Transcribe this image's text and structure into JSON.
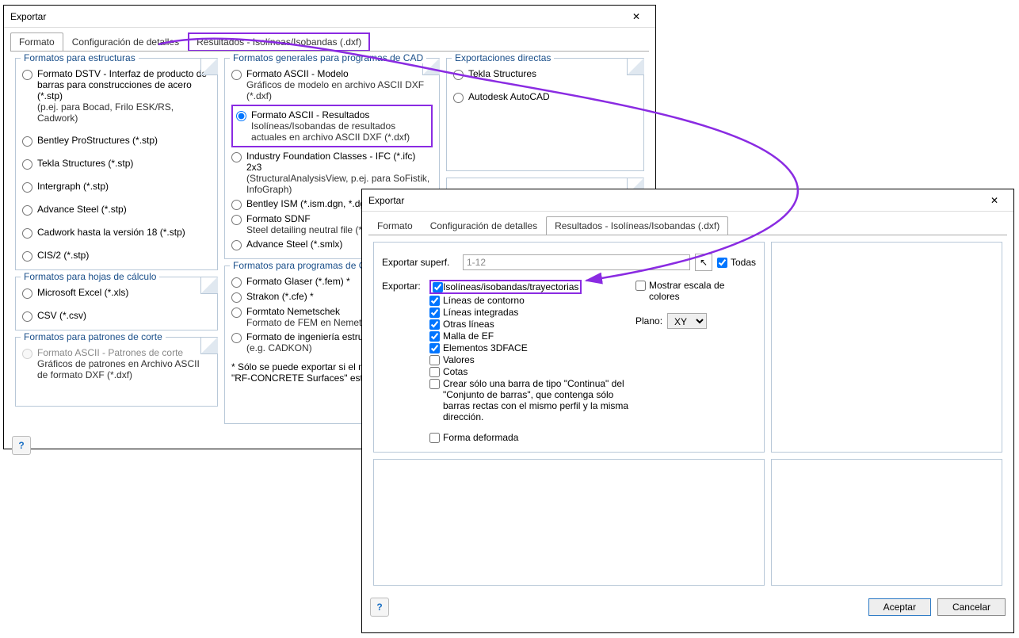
{
  "dialog1": {
    "title": "Exportar",
    "tabs": [
      "Formato",
      "Configuración de detalles",
      "Resultados - Isolíneas/Isobandas (.dxf)"
    ],
    "groups": {
      "estructuras": {
        "title": "Formatos para estructuras",
        "items": [
          {
            "label": "Formato DSTV - Interfaz de producto de barras para construcciones de acero (*.stp)",
            "sub": "(p.ej. para Bocad, Frilo ESK/RS, Cadwork)"
          },
          {
            "label": "Bentley ProStructures (*.stp)"
          },
          {
            "label": "Tekla Structures (*.stp)"
          },
          {
            "label": "Intergraph (*.stp)"
          },
          {
            "label": "Advance Steel (*.stp)"
          },
          {
            "label": "Cadwork hasta la versión 18 (*.stp)"
          },
          {
            "label": "CIS/2 (*.stp)"
          }
        ]
      },
      "hojas": {
        "title": "Formatos para hojas de cálculo",
        "items": [
          {
            "label": "Microsoft Excel (*.xls)"
          },
          {
            "label": "CSV (*.csv)"
          }
        ]
      },
      "patrones": {
        "title": "Formatos para patrones de corte",
        "items": [
          {
            "label": "Formato ASCII - Patrones de corte",
            "sub": "Gráficos de patrones en\nArchivo ASCII de formato DXF (*.dxf)",
            "disabled": true
          }
        ]
      },
      "cad": {
        "title": "Formatos generales para programas de CAD",
        "items": [
          {
            "label": "Formato ASCII - Modelo",
            "sub": "Gráficos de modelo en archivo ASCII DXF (*.dxf)"
          },
          {
            "label": "Formato ASCII - Resultados",
            "sub": "Isolíneas/Isobandas de resultados actuales en archivo ASCII DXF (*.dxf)",
            "selected": true,
            "hilite": true
          },
          {
            "label": "Industry Foundation Classes - IFC (*.ifc) 2x3",
            "sub": "(StructuralAnalysisView,\np.ej. para SoFistik, InfoGraph)"
          },
          {
            "label": "Bentley ISM (*.ism.dgn, *.dgn)"
          },
          {
            "label": "Formato SDNF",
            "sub": "Steel detailing neutral file (*.dat)"
          },
          {
            "label": "Advance Steel (*.smlx)"
          }
        ]
      },
      "cadfem": {
        "title": "Formatos para programas de CAD de FEM",
        "items": [
          {
            "label": "Formato Glaser (*.fem)  *"
          },
          {
            "label": "Strakon (*.cfe)  *"
          },
          {
            "label": "Formtato Nemetschek",
            "sub": "Formato de FEM en Nemetschek Allplan"
          },
          {
            "label": "Formato de ingeniería estructural",
            "sub": "(e.g. CADKON)"
          }
        ],
        "note": "*  Sólo se puede exportar si el módulo adicional \"RF-CONCRETE Surfaces\" está disponible."
      },
      "directas": {
        "title": "Exportaciones directas",
        "items": [
          {
            "label": "Tekla Structures"
          },
          {
            "label": "Autodesk AutoCAD"
          }
        ]
      }
    }
  },
  "dialog2": {
    "title": "Exportar",
    "tabs": [
      "Formato",
      "Configuración de detalles",
      "Resultados - Isolíneas/Isobandas (.dxf)"
    ],
    "surf_label": "Exportar superf.",
    "surf_value": "1-12",
    "all_label": "Todas",
    "export_label": "Exportar:",
    "checks": [
      {
        "label": "Isolíneas/isobandas/trayectorias",
        "checked": true,
        "hilite": true
      },
      {
        "label": "Líneas de contorno",
        "checked": true
      },
      {
        "label": "Líneas integradas",
        "checked": true
      },
      {
        "label": "Otras líneas",
        "checked": true
      },
      {
        "label": "Malla de EF",
        "checked": true
      },
      {
        "label": "Elementos 3DFACE",
        "checked": true
      },
      {
        "label": "Valores",
        "checked": false
      },
      {
        "label": "Cotas",
        "checked": false
      },
      {
        "label": "Crear sólo una barra de tipo \"Continua\" del \"Conjunto de barras\", que contenga sólo barras rectas con el mismo perfil y la misma dirección.",
        "checked": false
      },
      {
        "label": "Forma deformada",
        "checked": false,
        "gap": true
      }
    ],
    "scale_label": "Mostrar escala de colores",
    "plane_label": "Plano:",
    "plane_value": "XY",
    "ok": "Aceptar",
    "cancel": "Cancelar"
  }
}
